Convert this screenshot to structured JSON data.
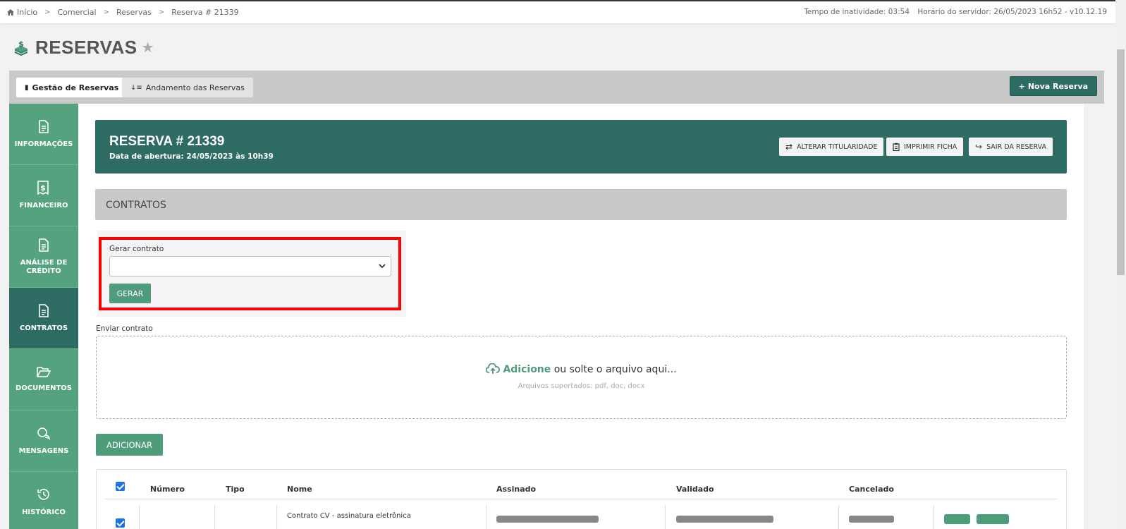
{
  "breadcrumb": [
    "Início",
    "Comercial",
    "Reservas",
    "Reserva # 21339"
  ],
  "status": {
    "inatividade": "Tempo de inatividade: 03:54",
    "servidor": "Horário do servidor: 26/05/2023 16h52 - v10.12.19"
  },
  "page": {
    "title": "RESERVAS"
  },
  "tabs": {
    "gestao": "Gestão de Reservas",
    "andamento": "Andamento das Reservas",
    "nova_reserva": "Nova Reserva"
  },
  "sidebar": {
    "items": [
      {
        "label": "INFORMAÇÕES",
        "icon": "document-icon"
      },
      {
        "label": "FINANCEIRO",
        "icon": "receipt-dollar-icon"
      },
      {
        "label": "ANÁLISE DE CRÉDITO",
        "icon": "document-icon"
      },
      {
        "label": "CONTRATOS",
        "icon": "document-icon",
        "active": true
      },
      {
        "label": "DOCUMENTOS",
        "icon": "folder-open-icon"
      },
      {
        "label": "MENSAGENS",
        "icon": "chat-bubbles-icon"
      },
      {
        "label": "HISTÓRICO",
        "icon": "history-icon"
      }
    ]
  },
  "reserva": {
    "title": "RESERVA # 21339",
    "date": "Data de abertura: 24/05/2023 às 10h39",
    "buttons": {
      "alterar": "ALTERAR TITULARIDADE",
      "imprimir": "IMPRIMIR FICHA",
      "sair": "SAIR DA RESERVA"
    }
  },
  "section": {
    "title": "CONTRATOS"
  },
  "gerar": {
    "label": "Gerar contrato",
    "selected": "",
    "button": "GERAR"
  },
  "enviar": {
    "label": "Enviar contrato",
    "add": "Adicione",
    "rest": " ou solte o arquivo aqui...",
    "sub": "Arquivos suportados: pdf, doc, docx"
  },
  "adicionar_button": "ADICIONAR",
  "table": {
    "headers": [
      "Número",
      "Tipo",
      "Nome",
      "Assinado",
      "Validado",
      "Cancelado"
    ],
    "rows": [
      {
        "nome": "Contrato CV - assinatura eletrônica"
      }
    ]
  },
  "colors": {
    "primary_dark": "#2e6b63",
    "primary": "#54a37e",
    "button_green": "#4f9c7a",
    "highlight_red": "#ff0000"
  }
}
